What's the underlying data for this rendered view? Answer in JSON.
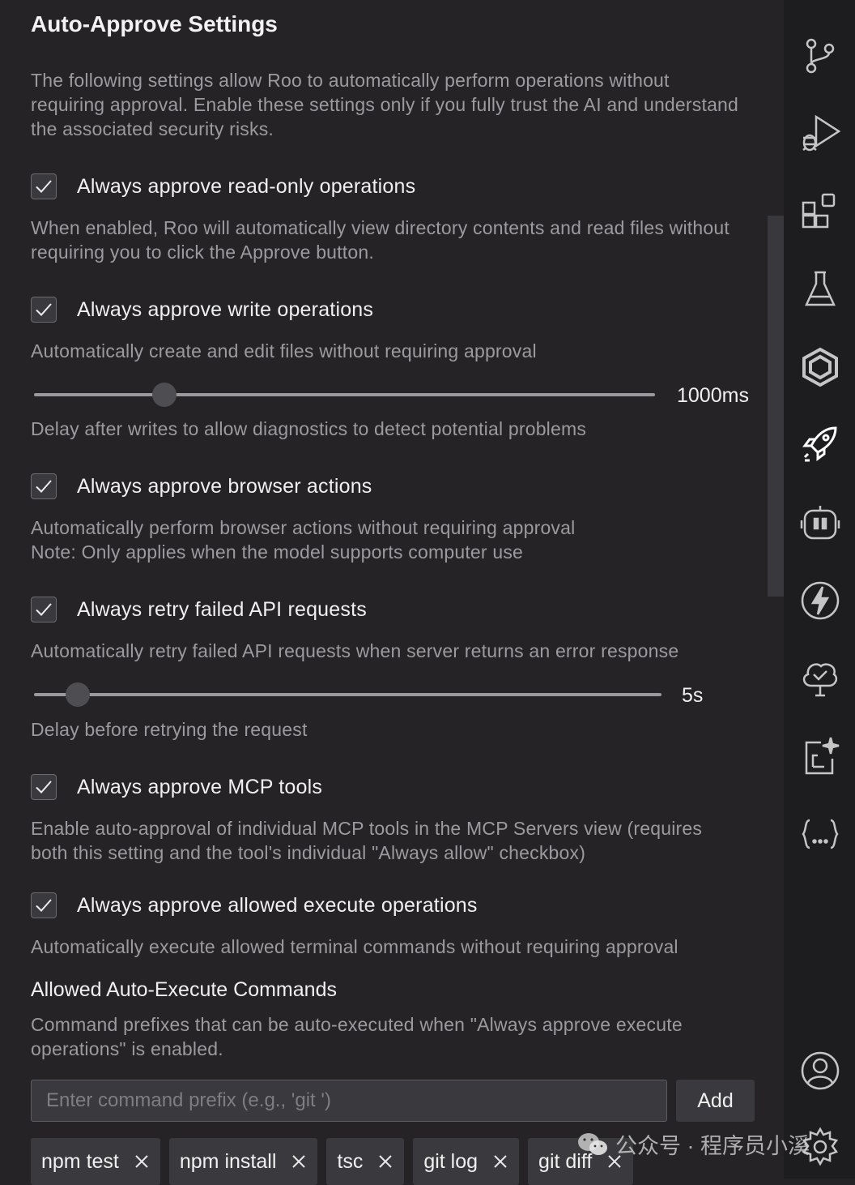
{
  "title": "Auto-Approve Settings",
  "intro": "The following settings allow Roo to automatically perform operations without requiring approval. Enable these settings only if you fully trust the AI and understand the associated security risks.",
  "options": [
    {
      "label": "Always approve read-only operations",
      "checked": true,
      "desc": "When enabled, Roo will automatically view directory contents and read files without requiring you to click the Approve button."
    },
    {
      "label": "Always approve write operations",
      "checked": true,
      "desc": "Automatically create and edit files without requiring approval"
    },
    {
      "label": "Always approve browser actions",
      "checked": true,
      "desc": "Automatically perform browser actions without requiring approval",
      "note": "Note: Only applies when the model supports computer use"
    },
    {
      "label": "Always retry failed API requests",
      "checked": true,
      "desc": "Automatically retry failed API requests when server returns an error response"
    },
    {
      "label": "Always approve MCP tools",
      "checked": true,
      "desc": "Enable auto-approval of individual MCP tools in the MCP Servers view (requires both this setting and the tool's individual \"Always allow\" checkbox)"
    },
    {
      "label": "Always approve allowed execute operations",
      "checked": true,
      "desc": "Automatically execute allowed terminal commands without requiring approval"
    }
  ],
  "write_delay": {
    "value_label": "1000ms",
    "fraction": 0.21,
    "desc": "Delay after writes to allow diagnostics to detect potential problems"
  },
  "retry_delay": {
    "value_label": "5s",
    "fraction": 0.07,
    "desc": "Delay before retrying the request"
  },
  "allowed_commands": {
    "heading": "Allowed Auto-Execute Commands",
    "desc": "Command prefixes that can be auto-executed when \"Always approve execute operations\" is enabled.",
    "placeholder": "Enter command prefix (e.g., 'git ')",
    "add_label": "Add",
    "items": [
      "npm test",
      "npm install",
      "tsc",
      "git log",
      "git diff"
    ]
  },
  "activity_bar": [
    "source-control-icon",
    "run-debug-icon",
    "extensions-icon",
    "testing-icon",
    "hexagon-icon",
    "rocket-icon",
    "robot-icon",
    "lightning-icon",
    "tree-check-icon",
    "sparkle-doc-icon",
    "braces-icon",
    "account-icon",
    "settings-gear-icon"
  ],
  "watermark": "公众号 · 程序员小溪"
}
